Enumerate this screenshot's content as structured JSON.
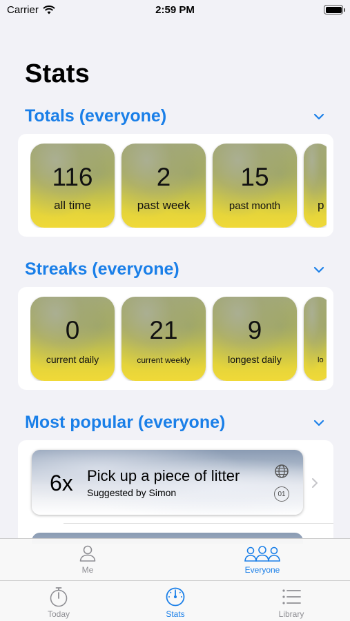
{
  "status": {
    "carrier": "Carrier",
    "time": "2:59 PM"
  },
  "title": "Stats",
  "totals": {
    "title": "Totals (everyone)",
    "tiles": [
      {
        "value": "116",
        "label": "all time"
      },
      {
        "value": "2",
        "label": "past week"
      },
      {
        "value": "15",
        "label": "past month"
      },
      {
        "value": "",
        "label": "p"
      }
    ]
  },
  "streaks": {
    "title": "Streaks (everyone)",
    "tiles": [
      {
        "value": "0",
        "label": "current daily"
      },
      {
        "value": "21",
        "label": "current weekly"
      },
      {
        "value": "9",
        "label": "longest daily"
      },
      {
        "value": "",
        "label": "lo"
      }
    ]
  },
  "popular": {
    "title": "Most popular (everyone)",
    "items": [
      {
        "count": "6x",
        "title": "Pick up a piece of litter",
        "subtitle": "Suggested by Simon",
        "badge": "01"
      }
    ]
  },
  "scope_tabs": [
    {
      "label": "Me",
      "icon": "person-icon",
      "selected": false
    },
    {
      "label": "Everyone",
      "icon": "people-icon",
      "selected": true
    }
  ],
  "tabs": [
    {
      "label": "Today",
      "icon": "stopwatch-icon",
      "selected": false
    },
    {
      "label": "Stats",
      "icon": "gauge-icon",
      "selected": true
    },
    {
      "label": "Library",
      "icon": "list-icon",
      "selected": false
    }
  ],
  "colors": {
    "accent": "#1a7fe8",
    "inactive": "#8e8e93"
  }
}
